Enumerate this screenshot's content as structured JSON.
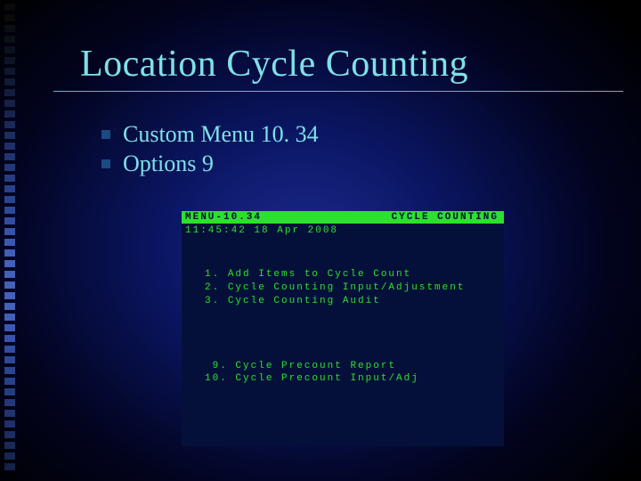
{
  "slide": {
    "title": "Location Cycle Counting",
    "bullets": [
      "Custom Menu 10. 34",
      "Options 9"
    ]
  },
  "terminal": {
    "header_left": "MENU-10.34",
    "header_right": "CYCLE COUNTING",
    "timestamp": "11:45:42  18 Apr 2008",
    "menu_top": [
      {
        "num": "1.",
        "label": "Add Items to Cycle Count"
      },
      {
        "num": "2.",
        "label": "Cycle Counting Input/Adjustment"
      },
      {
        "num": "3.",
        "label": "Cycle Counting Audit"
      }
    ],
    "menu_bottom": [
      {
        "num": " 9.",
        "label": "Cycle Precount Report"
      },
      {
        "num": "10.",
        "label": "Cycle Precount Input/Adj"
      }
    ]
  },
  "decor": {
    "stripe_colors": [
      "#0a0a0a",
      "#0a0a0a",
      "#0b0d14",
      "#0b0f18",
      "#0c111e",
      "#0e1426",
      "#0f172e",
      "#111a36",
      "#131e3e",
      "#152146",
      "#17254f",
      "#1a2957",
      "#1c2d5f",
      "#1e3067",
      "#21346f",
      "#233877",
      "#263c7f",
      "#284088",
      "#2b4490",
      "#2e4898",
      "#324ca0",
      "#3752a8",
      "#3c58b0",
      "#415eb8",
      "#4460b8",
      "#4460b8",
      "#4460b8",
      "#4460b8",
      "#4460b8",
      "#415eb8",
      "#3c58b0",
      "#3752a8",
      "#324ca0",
      "#2e4898",
      "#2b4490",
      "#284088",
      "#263c7f",
      "#233877",
      "#21346f",
      "#1e3067",
      "#1c2d5f",
      "#1a2957",
      "#17254f",
      "#152146"
    ]
  }
}
